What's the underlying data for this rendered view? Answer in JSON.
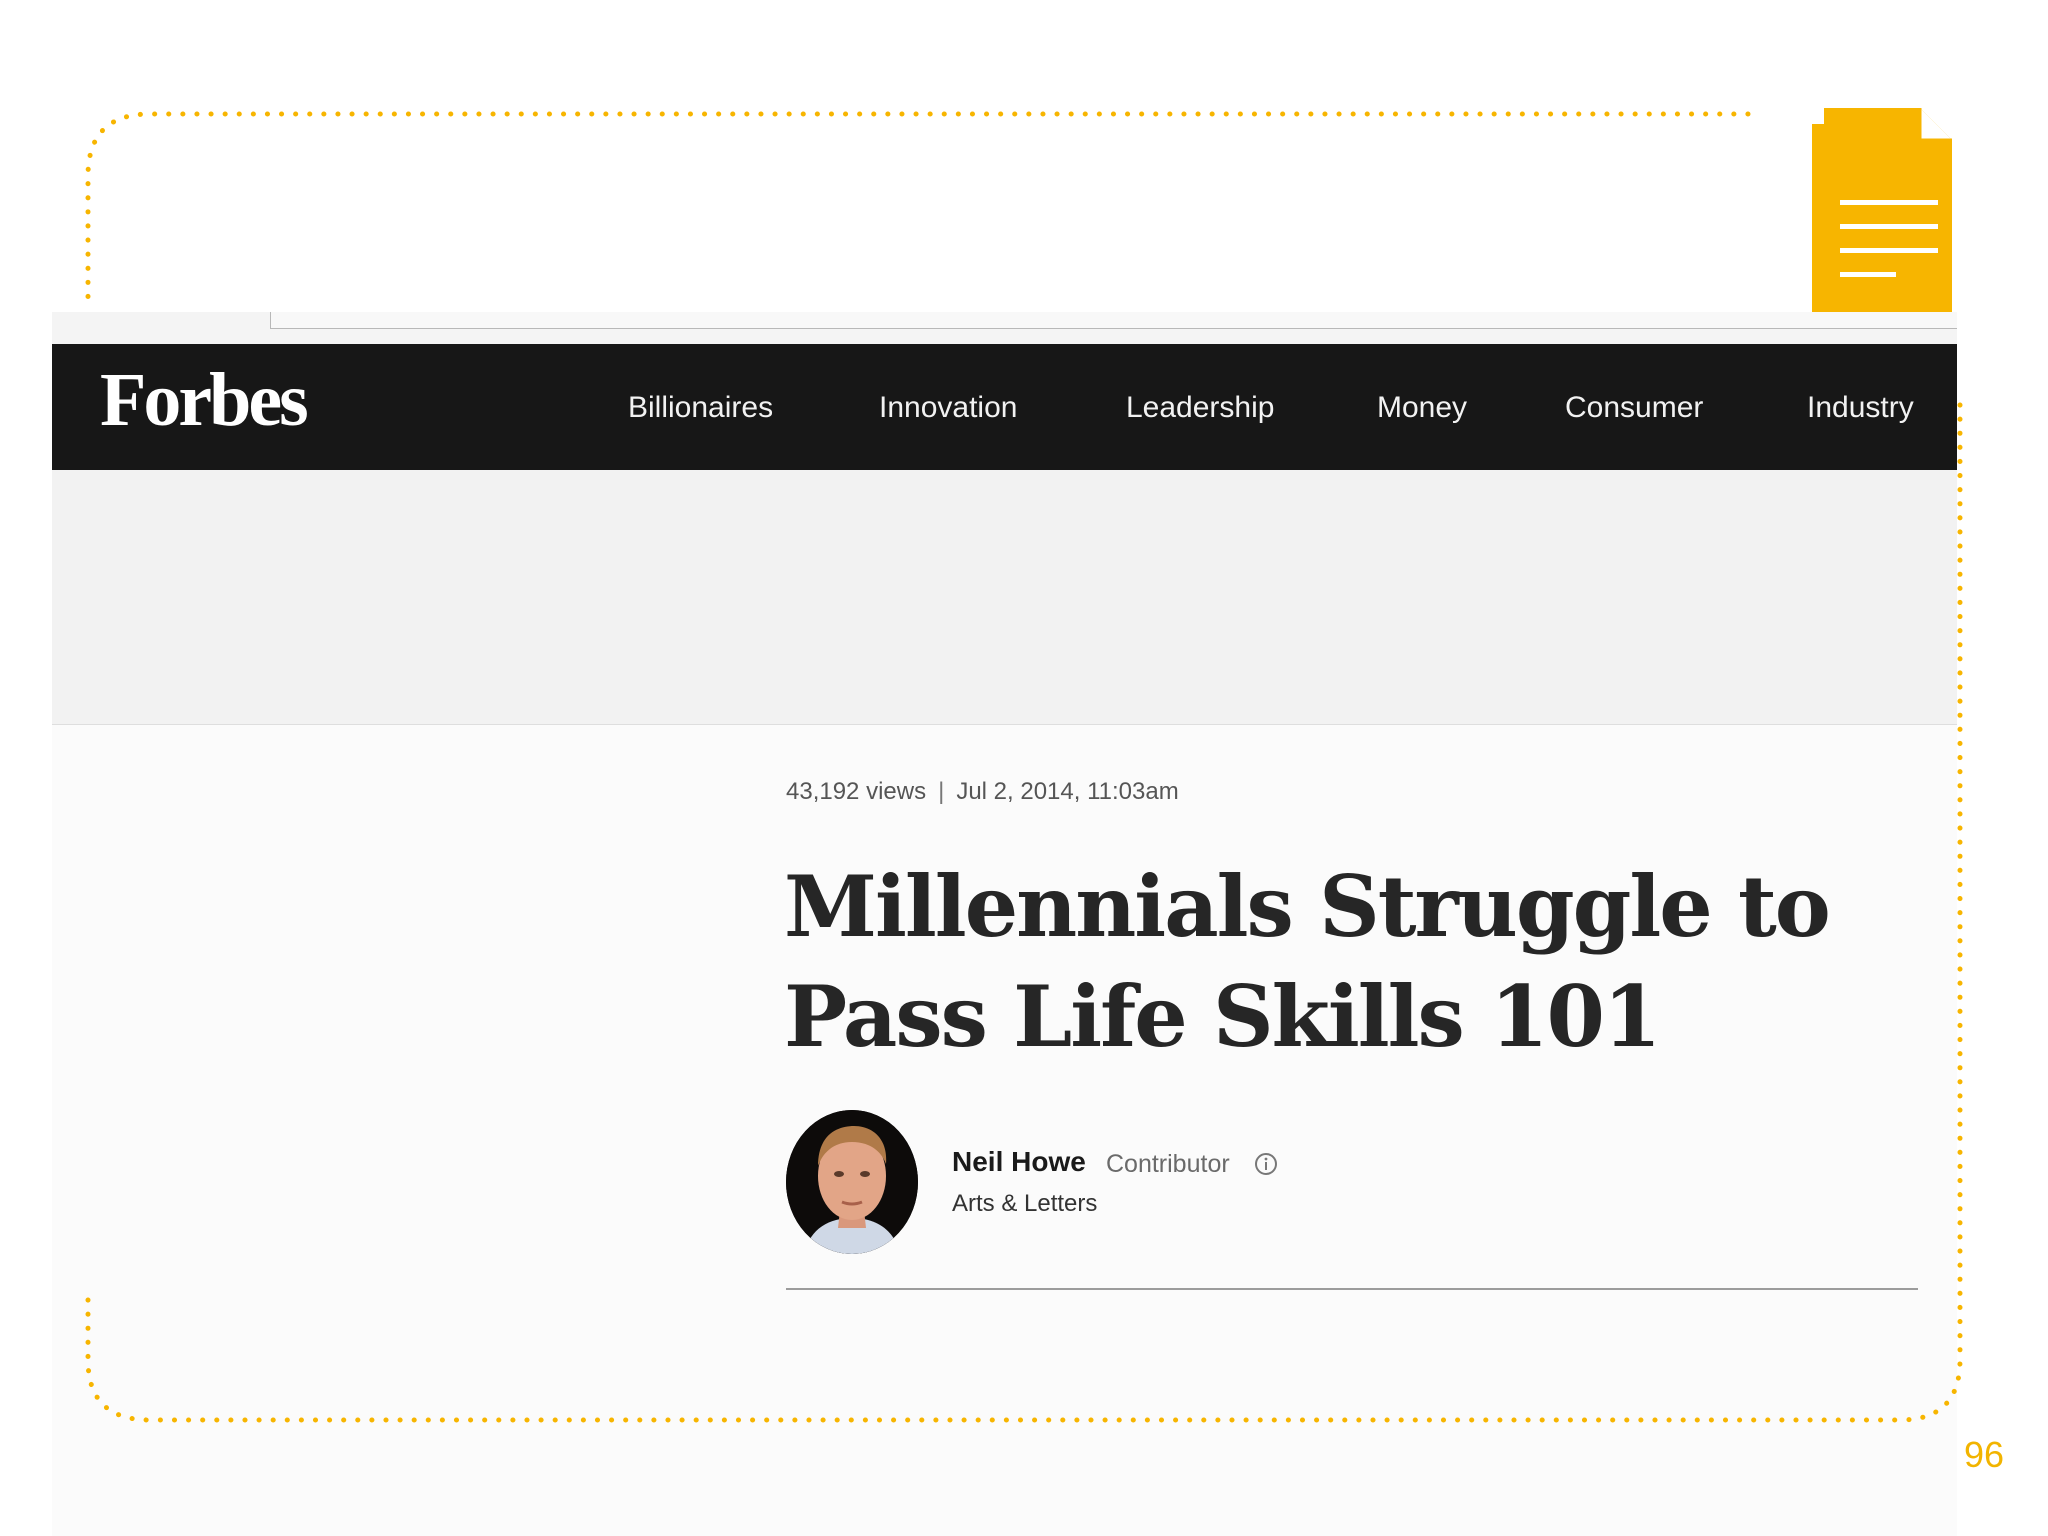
{
  "browser": {
    "brand": "Forbes",
    "nav_items": [
      "Billionaires",
      "Innovation",
      "Leadership",
      "Money",
      "Consumer",
      "Industry"
    ]
  },
  "article": {
    "views": "43,192 views",
    "separator": "|",
    "date": "Jul 2, 2014, 11:03am",
    "title": "Millennials Struggle to Pass Life Skills 101",
    "author": {
      "name": "Neil Howe",
      "role": "Contributor",
      "section": "Arts & Letters"
    }
  },
  "slide": {
    "page_number": "96",
    "accent_color": "#F7B500",
    "icon": "document-icon"
  }
}
